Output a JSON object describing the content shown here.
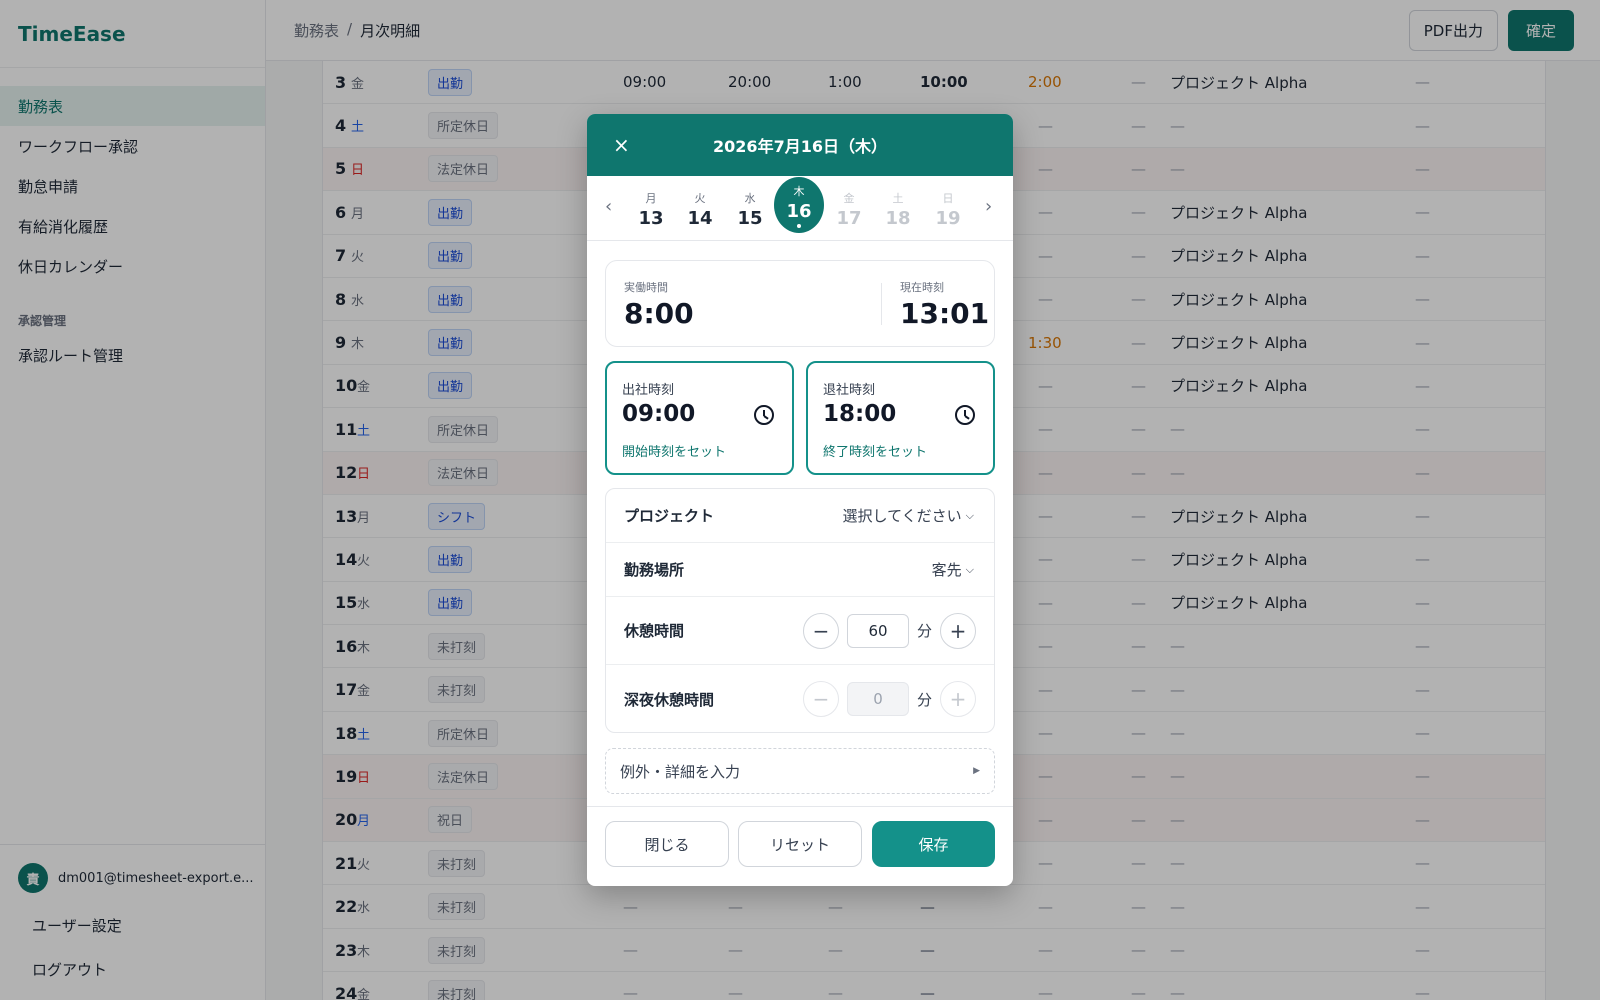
{
  "app": {
    "name": "TimeEase"
  },
  "sidebar": {
    "items": [
      {
        "label": "勤務表",
        "active": true
      },
      {
        "label": "ワークフロー承認"
      },
      {
        "label": "勤怠申請"
      },
      {
        "label": "有給消化履歴"
      },
      {
        "label": "休日カレンダー"
      }
    ],
    "section_label": "承認管理",
    "section_items": [
      {
        "label": "承認ルート管理"
      }
    ],
    "user": {
      "avatar_text": "責",
      "email": "dm001@timesheet-export.e..."
    },
    "footer_links": [
      {
        "label": "ユーザー設定"
      },
      {
        "label": "ログアウト"
      }
    ]
  },
  "header": {
    "breadcrumb": [
      "勤務表",
      "/",
      "月次明細"
    ],
    "pdf_button": "PDF出力",
    "confirm_button": "確定"
  },
  "table": {
    "rows": [
      {
        "day": "3",
        "wd": "金",
        "type": "出勤",
        "kind": "work",
        "start": "09:00",
        "end": "20:00",
        "break": "1:00",
        "work": "10:00",
        "ot": "2:00",
        "ot2": "—",
        "project": "プロジェクト Alpha",
        "note": "—"
      },
      {
        "day": "4",
        "wd": "土",
        "type": "所定休日",
        "kind": "off",
        "col7": "—",
        "ot2": "—",
        "project": "—",
        "note": "—"
      },
      {
        "day": "5",
        "wd": "日",
        "type": "法定休日",
        "kind": "off",
        "holiday": true,
        "col7": "—",
        "ot2": "—",
        "project": "—",
        "note": "—"
      },
      {
        "day": "6",
        "wd": "月",
        "type": "出勤",
        "kind": "work",
        "col7": "—",
        "ot2": "—",
        "project": "プロジェクト Alpha",
        "note": "—"
      },
      {
        "day": "7",
        "wd": "火",
        "type": "出勤",
        "kind": "work",
        "col7": "—",
        "ot2": "—",
        "project": "プロジェクト Alpha",
        "note": "—"
      },
      {
        "day": "8",
        "wd": "水",
        "type": "出勤",
        "kind": "work",
        "col7": "—",
        "ot2": "—",
        "project": "プロジェクト Alpha",
        "note": "—"
      },
      {
        "day": "9",
        "wd": "木",
        "type": "出勤",
        "kind": "work",
        "ot": "1:30",
        "ot2": "—",
        "project": "プロジェクト Alpha",
        "note": "—"
      },
      {
        "day": "10",
        "wd": "金",
        "type": "出勤",
        "kind": "work",
        "col7": "—",
        "ot2": "—",
        "project": "プロジェクト Alpha",
        "note": "—"
      },
      {
        "day": "11",
        "wd": "土",
        "type": "所定休日",
        "kind": "off",
        "col7": "—",
        "ot2": "—",
        "project": "—",
        "note": "—"
      },
      {
        "day": "12",
        "wd": "日",
        "type": "法定休日",
        "kind": "off",
        "holiday": true,
        "col7": "—",
        "ot2": "—",
        "project": "—",
        "note": "—"
      },
      {
        "day": "13",
        "wd": "月",
        "type": "シフト",
        "kind": "shift",
        "col7": "—",
        "ot2": "—",
        "project": "プロジェクト Alpha",
        "note": "—"
      },
      {
        "day": "14",
        "wd": "火",
        "type": "出勤",
        "kind": "work",
        "col7": "—",
        "ot2": "—",
        "project": "プロジェクト Alpha",
        "note": "—"
      },
      {
        "day": "15",
        "wd": "水",
        "type": "出勤",
        "kind": "work",
        "col7": "—",
        "ot2": "—",
        "project": "プロジェクト Alpha",
        "note": "—"
      },
      {
        "day": "16",
        "wd": "木",
        "type": "未打刻",
        "kind": "off",
        "col7": "—",
        "ot2": "—",
        "project": "—",
        "note": "—"
      },
      {
        "day": "17",
        "wd": "金",
        "type": "未打刻",
        "kind": "off",
        "col7": "—",
        "ot2": "—",
        "project": "—",
        "note": "—"
      },
      {
        "day": "18",
        "wd": "土",
        "type": "所定休日",
        "kind": "off",
        "col7": "—",
        "ot2": "—",
        "project": "—",
        "note": "—"
      },
      {
        "day": "19",
        "wd": "日",
        "type": "法定休日",
        "kind": "off",
        "holiday": true,
        "col7": "—",
        "ot2": "—",
        "project": "—",
        "note": "—"
      },
      {
        "day": "20",
        "wd": "月",
        "type": "祝日",
        "kind": "off",
        "holiday": true,
        "col7": "—",
        "ot2": "—",
        "project": "—",
        "note": "—"
      },
      {
        "day": "21",
        "wd": "火",
        "type": "未打刻",
        "kind": "off",
        "col7": "—",
        "ot2": "—",
        "project": "—",
        "note": "—"
      },
      {
        "day": "22",
        "wd": "水",
        "type": "未打刻",
        "kind": "off",
        "start": "—",
        "end": "—",
        "break": "—",
        "work": "—",
        "col7": "—",
        "ot2": "—",
        "project": "—",
        "note": "—"
      },
      {
        "day": "23",
        "wd": "木",
        "type": "未打刻",
        "kind": "off",
        "start": "—",
        "end": "—",
        "break": "—",
        "work": "—",
        "col7": "—",
        "ot2": "—",
        "project": "—",
        "note": "—"
      },
      {
        "day": "24",
        "wd": "金",
        "type": "未打刻",
        "kind": "off",
        "start": "—",
        "end": "—",
        "break": "—",
        "work": "—",
        "col7": "—",
        "ot2": "—",
        "project": "—",
        "note": "—"
      }
    ]
  },
  "modal": {
    "title": "2026年7月16日（木）",
    "close_icon": "×",
    "prev_icon": "‹",
    "next_icon": "›",
    "week": [
      {
        "wd": "月",
        "d": "13"
      },
      {
        "wd": "火",
        "d": "14"
      },
      {
        "wd": "水",
        "d": "15"
      },
      {
        "wd": "木",
        "d": "16",
        "selected": true
      },
      {
        "wd": "金",
        "d": "17",
        "future": true
      },
      {
        "wd": "土",
        "d": "18",
        "future": true
      },
      {
        "wd": "日",
        "d": "19",
        "future": true
      }
    ],
    "summary": {
      "actual_label": "実働時間",
      "actual_value": "8:00",
      "now_label": "現在時刻",
      "now_value": "13:01"
    },
    "start": {
      "label": "出社時刻",
      "value": "09:00",
      "link": "開始時刻をセット"
    },
    "end": {
      "label": "退社時刻",
      "value": "18:00",
      "link": "終了時刻をセット"
    },
    "project": {
      "label": "プロジェクト",
      "value": "選択してください"
    },
    "location": {
      "label": "勤務場所",
      "value": "客先"
    },
    "break": {
      "label": "休憩時間",
      "value": "60",
      "unit": "分"
    },
    "night_break": {
      "label": "深夜休憩時間",
      "value": "0",
      "unit": "分"
    },
    "exception": {
      "label": "例外・詳細を入力"
    },
    "buttons": {
      "close": "閉じる",
      "reset": "リセット",
      "save": "保存"
    }
  },
  "colors": {
    "accent": "#0f766e",
    "accent_light": "#14918a",
    "overtime": "#d97706"
  }
}
